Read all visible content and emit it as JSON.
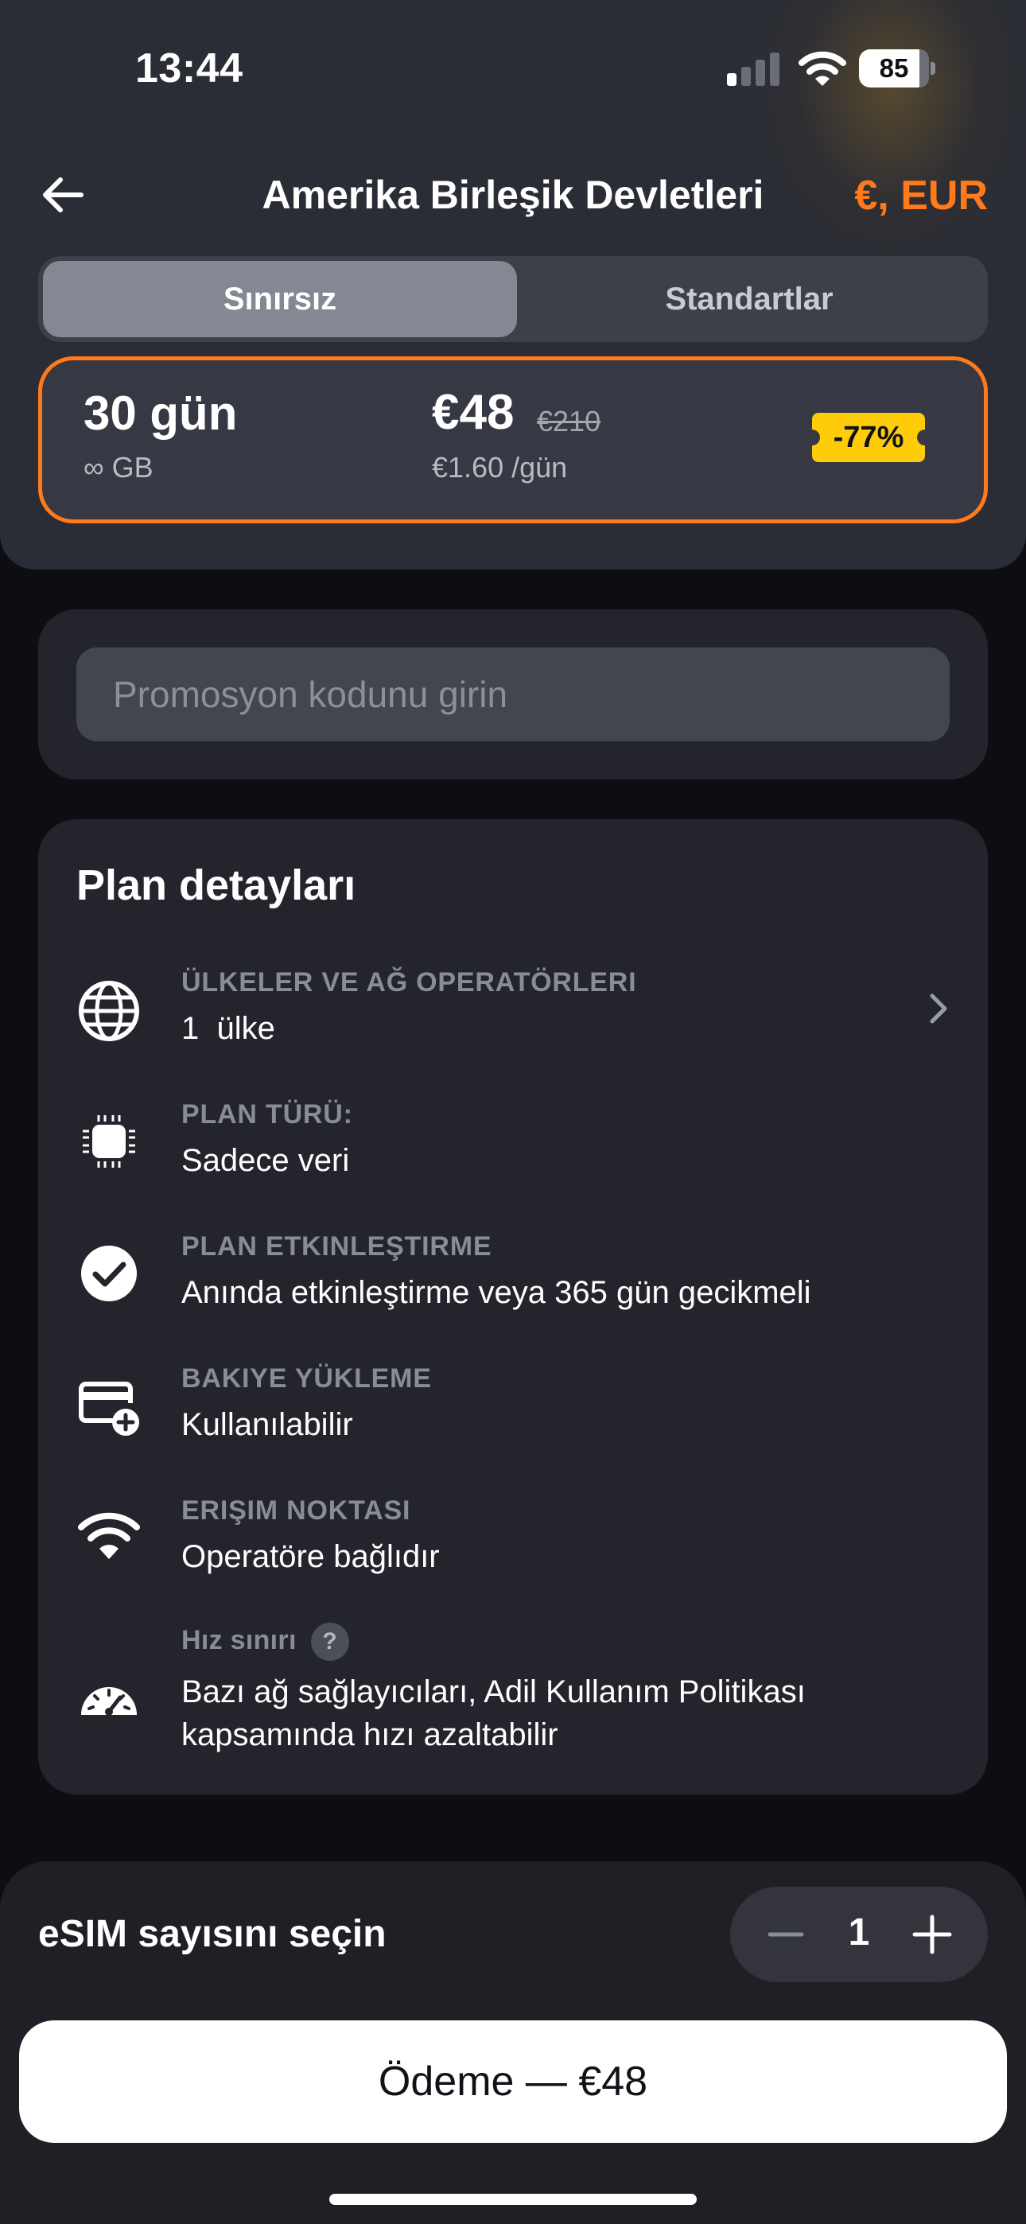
{
  "status_bar": {
    "time": "13:44",
    "battery": "85",
    "icons": [
      "signal-icon",
      "wifi-icon",
      "battery-icon"
    ]
  },
  "header": {
    "title": "Amerika Birleşik Devletleri",
    "currency": "€, EUR",
    "back_icon": "arrow-left-icon"
  },
  "tabs": [
    {
      "label": "Sınırsız",
      "selected": true
    },
    {
      "label": "Standartlar",
      "selected": false
    }
  ],
  "plan": {
    "days": "30 gün",
    "data": "∞ GB",
    "price": "€48",
    "old_price": "€210",
    "per_day": "€1.60 /gün",
    "discount": "-77%"
  },
  "promo": {
    "placeholder": "Promosyon kodunu girin",
    "value": ""
  },
  "details": {
    "title": "Plan detayları",
    "items": [
      {
        "icon": "globe-icon",
        "label": "ÜLKELER VE AĞ OPERATÖRLERI",
        "value": "1  ülke",
        "has_chevron": true
      },
      {
        "icon": "chip-icon",
        "label": "PLAN TÜRÜ:",
        "value": "Sadece veri"
      },
      {
        "icon": "check-circle-icon",
        "label": "PLAN ETKINLEŞTIRME",
        "value": "Anında etkinleştirme veya 365 gün gecikmeli"
      },
      {
        "icon": "card-add-icon",
        "label": "BAKIYE YÜKLEME",
        "value": "Kullanılabilir"
      },
      {
        "icon": "wifi-icon",
        "label": "ERIŞIM NOKTASI",
        "value": "Operatöre bağlıdır"
      },
      {
        "icon": "speedometer-icon",
        "label": "Hız sınırı",
        "help": "?",
        "value": "Bazı ağ sağlayıcıları, Adil Kullanım Politikası kapsamında hızı azaltabilir"
      }
    ]
  },
  "order": {
    "esim_label": "eSIM sayısını seçin",
    "quantity": "1",
    "checkout_label": "Ödeme — €48"
  },
  "colors": {
    "accent": "#ff7a1a",
    "discount_badge": "#ffcc0a",
    "background": "#0d0e11",
    "card": "#24252c"
  }
}
